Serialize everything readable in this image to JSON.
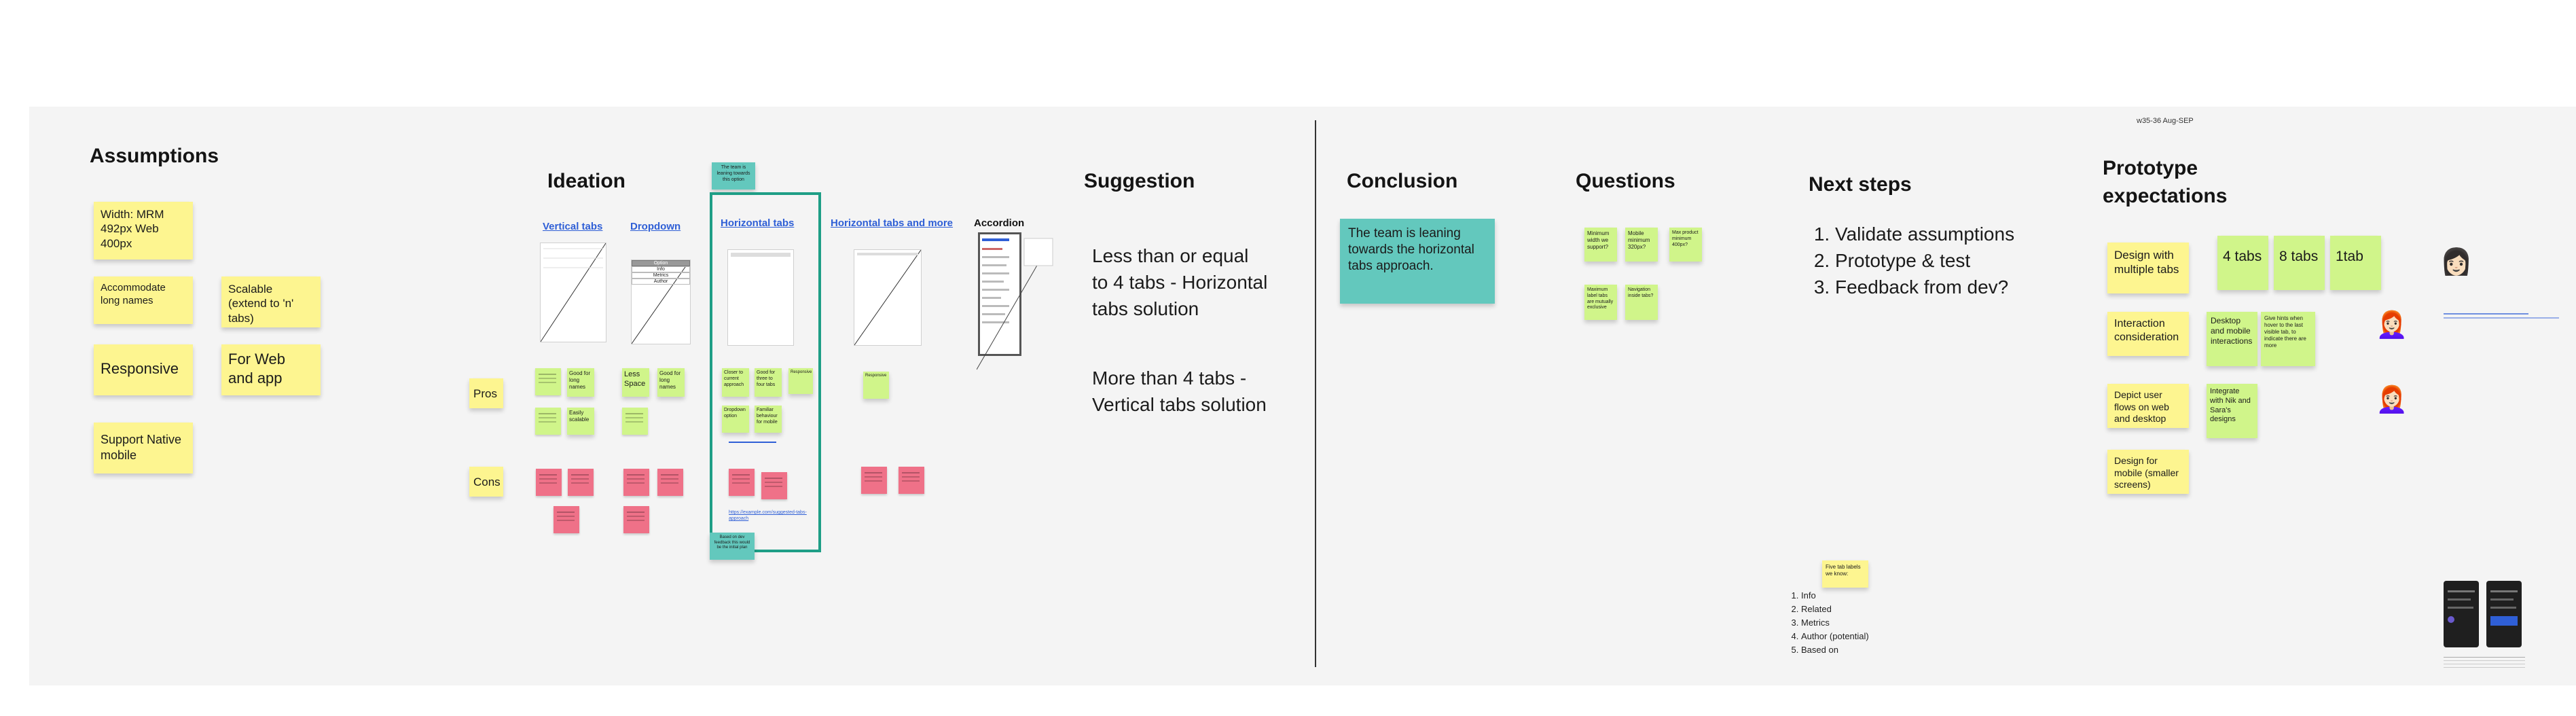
{
  "board": {
    "top_label": "w35-36  Aug-SEP",
    "sections": {
      "assumptions": "Assumptions",
      "ideation": "Ideation",
      "suggestion": "Suggestion",
      "conclusion": "Conclusion",
      "questions": "Questions",
      "next_steps": "Next steps",
      "prototype": "Prototype expectations"
    }
  },
  "assumptions": [
    "Width: MRM 492px Web 400px",
    "Accommodate long names",
    "Scalable (extend to 'n' tabs)",
    "Responsive",
    "For Web and app",
    "Support Native mobile"
  ],
  "ideation": {
    "columns": [
      "Vertical tabs",
      "Dropdown",
      "Horizontal tabs",
      "Horizontal tabs and more",
      "Accordion"
    ],
    "row_labels": [
      "Pros",
      "Cons"
    ],
    "notes": {
      "team_note": "The team is leaning towards this option",
      "less_space": "Less Space",
      "good_long_names_1": "Good for long names",
      "good_long_names_2": "Good for long names",
      "easily_scalable": "Easily scalable",
      "responsive_pro": "Responsive",
      "closer_current": "Closer to current approach",
      "good_four_tabs": "Good for three to four tabs",
      "responsive_ht": "Responsive",
      "dropdown_option": "Dropdown option",
      "familiar_behaviour": "Familiar behaviour for mobile",
      "adjusts": "Adjusts to all tab widths",
      "responsive_hm": "Responsive",
      "bottom_note": "Based on dev feedback this would be the initial plan",
      "link_text": "https://example.com/suggested-tabs-approach"
    },
    "dropdown_options": [
      "Option",
      "Info",
      "Metrics",
      "Author"
    ]
  },
  "suggestion": {
    "text_1": "Less than or equal to 4 tabs - Horizontal tabs solution",
    "text_2": "More than 4 tabs - Vertical tabs solution"
  },
  "conclusion": {
    "text": "The team is leaning towards the horizontal tabs approach."
  },
  "questions": [
    "Minimum width we support?",
    "Mobile minimum 320px?",
    "Max product minimum 400px?",
    "Maximum label tabs are mutually exclusive",
    "Navigation inside tabs?"
  ],
  "next_steps": {
    "items": [
      "Validate assumptions",
      "Prototype & test",
      "Feedback from dev?"
    ]
  },
  "tabs_note": "Five tab labels we know:",
  "tab_labels": [
    "Info",
    "Related",
    "Metrics",
    "Author (potential)",
    "Based on"
  ],
  "prototype": {
    "notes": [
      "Design with multiple tabs",
      "4 tabs",
      "8 tabs",
      "1tab",
      "Interaction consideration",
      "Desktop and mobile interactions",
      "Give hints when hover to the last visible tab, to indicate there are more",
      "Depict user flows on web and desktop app",
      "Integrate with Nik and Sara's designs",
      "Design for mobile (smaller screens)"
    ]
  },
  "colors": {
    "yellow": "#fdf590",
    "green": "#d0f58a",
    "red": "#ef7188",
    "teal": "#63c8bd",
    "frame": "#1e9e86",
    "link": "#2f5fd6"
  }
}
